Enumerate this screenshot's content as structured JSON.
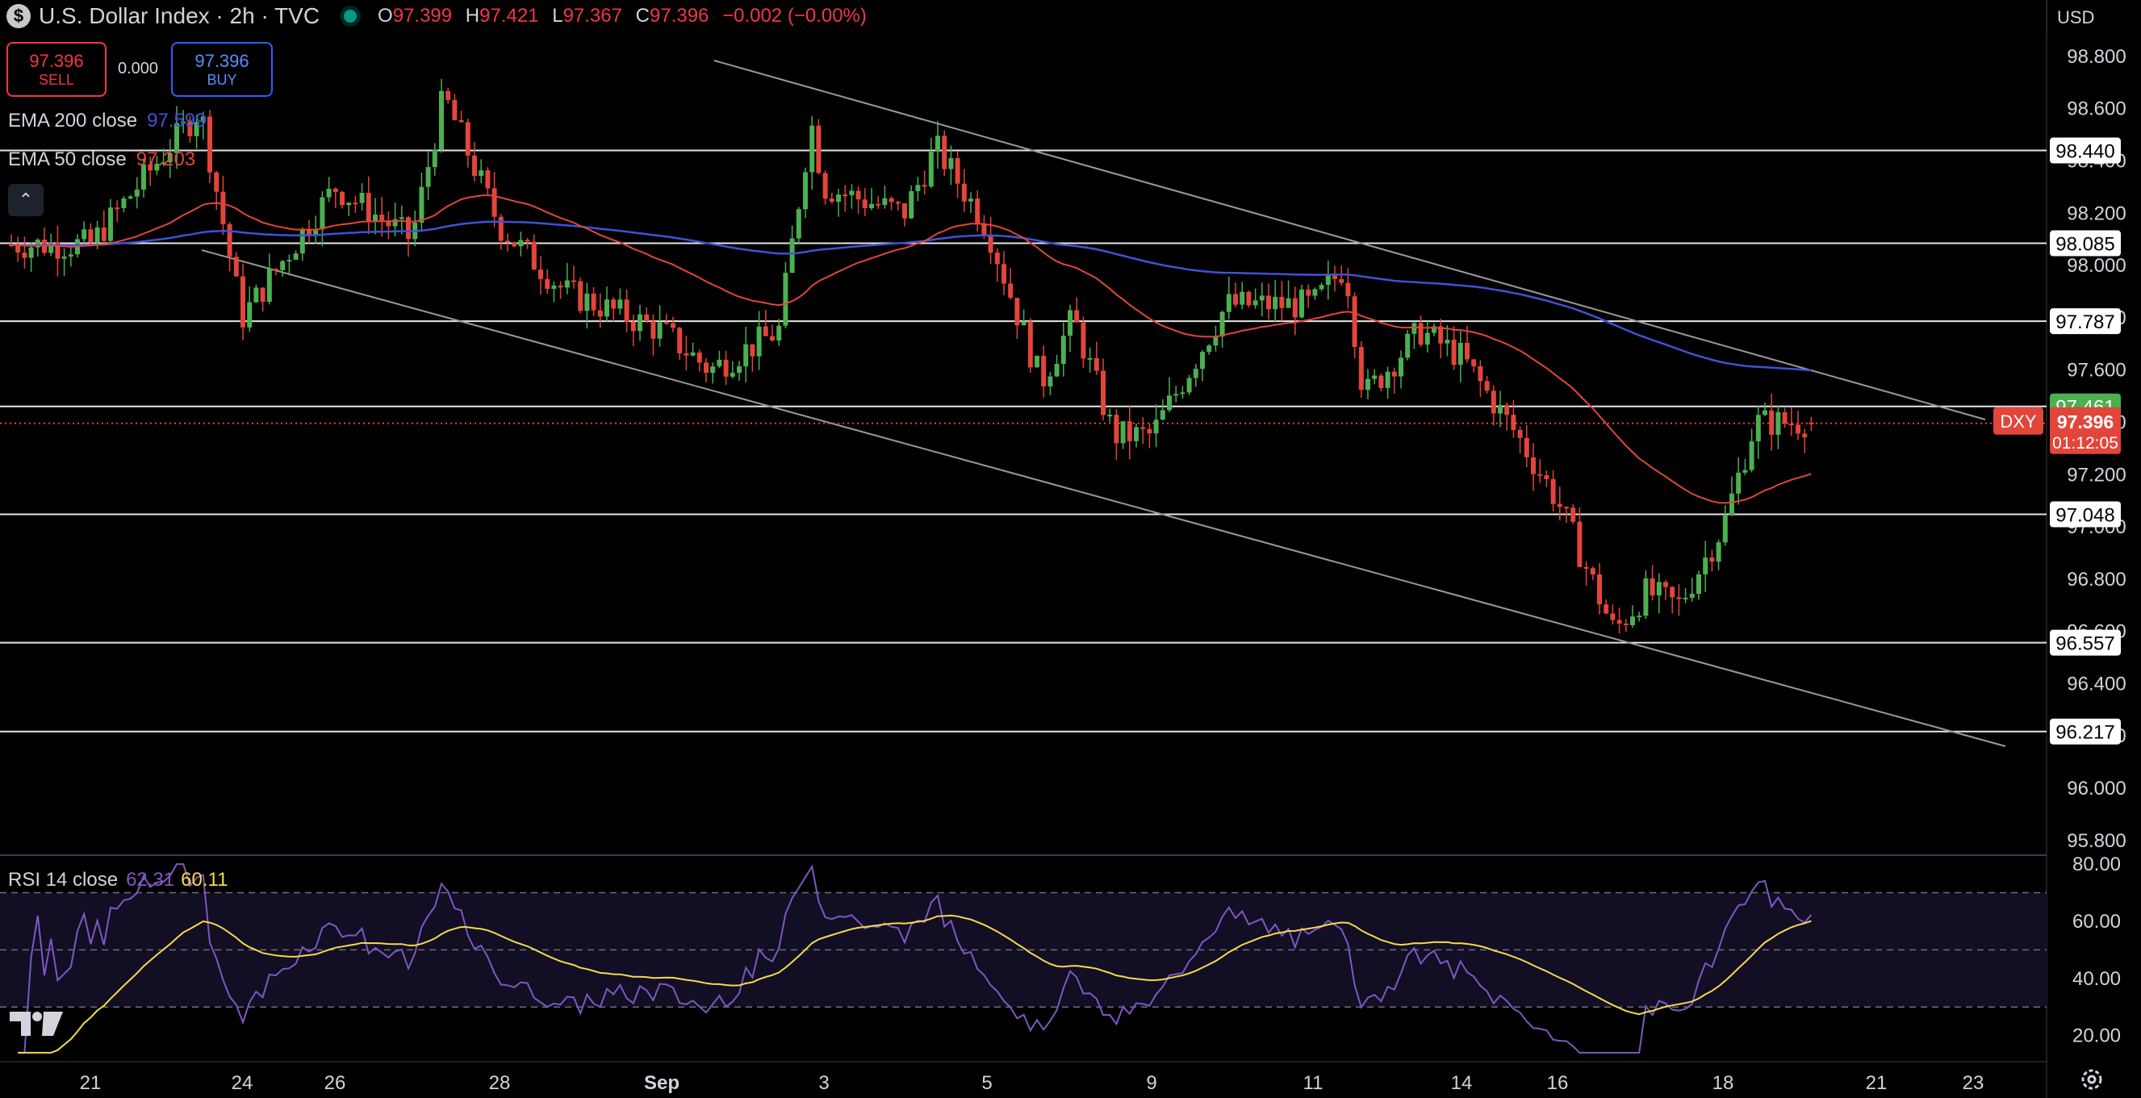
{
  "header": {
    "currency_symbol": "$",
    "title": "U.S. Dollar Index · 2h · TVC",
    "ohlc": {
      "o_label": "O",
      "o_value": "97.399",
      "h_label": "H",
      "h_value": "97.421",
      "l_label": "L",
      "l_value": "97.367",
      "c_label": "C",
      "c_value": "97.396",
      "change": "−0.002 (−0.00%)"
    }
  },
  "trade": {
    "sell_price": "97.396",
    "sell_label": "SELL",
    "spread": "0.000",
    "buy_price": "97.396",
    "buy_label": "BUY"
  },
  "indicators": {
    "ema200_label": "EMA 200 close",
    "ema200_value": "97.599",
    "ema50_label": "EMA 50 close",
    "ema50_value": "97.203",
    "rsi_label": "RSI 14 close",
    "rsi_value": "62.31",
    "rsi_ma_value": "60.11"
  },
  "currency_selector": "USD",
  "colors": {
    "up": "#4caf50",
    "down": "#e2453a",
    "ema200": "#3f51d8",
    "ema50": "#e2453a",
    "rsi": "#7e57c2",
    "rsi_ma": "#f7d94c"
  },
  "chart_data": [
    {
      "type": "candlestick",
      "symbol": "DXY",
      "interval": "2h",
      "y_axis_ticks": [
        "98.800",
        "98.600",
        "98.400",
        "98.200",
        "98.000",
        "97.800",
        "97.600",
        "97.400",
        "97.200",
        "97.000",
        "96.800",
        "96.600",
        "96.400",
        "96.200",
        "96.000",
        "95.800"
      ],
      "x_axis_ticks": [
        "21",
        "24",
        "26",
        "28",
        "Sep",
        "3",
        "5",
        "9",
        "11",
        "14",
        "16",
        "18",
        "21",
        "23"
      ],
      "ylim": [
        95.75,
        98.88
      ],
      "horizontal_levels": [
        {
          "label": "98.440",
          "value": 98.44
        },
        {
          "label": "98.085",
          "value": 98.085
        },
        {
          "label": "97.787",
          "value": 97.787
        },
        {
          "label": "97.461",
          "value": 97.461
        },
        {
          "label": "97.048",
          "value": 97.048
        },
        {
          "label": "96.557",
          "value": 96.557
        },
        {
          "label": "96.217",
          "value": 96.217
        }
      ],
      "last_price": {
        "symbol": "DXY",
        "value": "97.396",
        "countdown": "01:12:05"
      },
      "approx_close_path": [
        [
          "21",
          98.08
        ],
        [
          "23",
          98.6
        ],
        [
          "24",
          97.8
        ],
        [
          "26",
          98.3
        ],
        [
          "27",
          98.1
        ],
        [
          "27",
          98.65
        ],
        [
          "28",
          98.15
        ],
        [
          "29",
          97.9
        ],
        [
          "Sep",
          97.75
        ],
        [
          "1",
          97.6
        ],
        [
          "2",
          97.75
        ],
        [
          "2",
          98.55
        ],
        [
          "3",
          98.3
        ],
        [
          "4",
          98.2
        ],
        [
          "4",
          98.45
        ],
        [
          "5",
          98.15
        ],
        [
          "6",
          97.55
        ],
        [
          "6",
          97.8
        ],
        [
          "8",
          97.35
        ],
        [
          "9",
          97.35
        ],
        [
          "10",
          97.85
        ],
        [
          "11",
          97.85
        ],
        [
          "11",
          98.0
        ],
        [
          "12",
          97.5
        ],
        [
          "13",
          97.75
        ],
        [
          "14",
          97.65
        ],
        [
          "15",
          97.35
        ],
        [
          "16",
          97.1
        ],
        [
          "17",
          96.6
        ],
        [
          "17",
          96.75
        ],
        [
          "17",
          96.7
        ],
        [
          "18",
          97.0
        ],
        [
          "18",
          97.4
        ],
        [
          "19",
          97.4
        ]
      ],
      "ema200_value": 97.599,
      "ema50_value": 97.203
    },
    {
      "type": "line",
      "title": "RSI 14 close",
      "y_axis_ticks": [
        "80.00",
        "60.00",
        "40.00",
        "20.00"
      ],
      "ylim": [
        12,
        82
      ],
      "bands": [
        70,
        50,
        30
      ],
      "series": [
        {
          "name": "RSI 14 close",
          "last": 62.31
        },
        {
          "name": "RSI MA",
          "last": 60.11
        }
      ]
    }
  ]
}
